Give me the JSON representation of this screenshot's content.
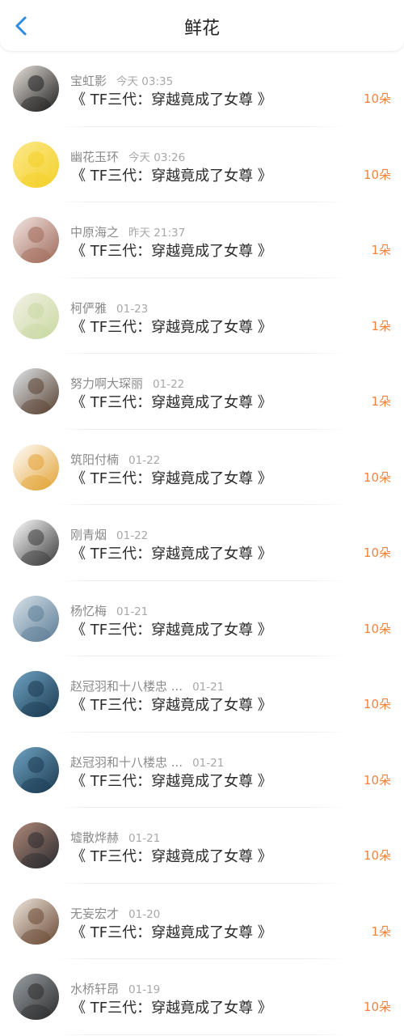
{
  "header": {
    "title": "鲜花",
    "back_icon": "chevron-left-icon",
    "back_color": "#2f8ae0"
  },
  "accent_color": "#f0843e",
  "items": [
    {
      "name": "宝虹影",
      "time": "今天 03:35",
      "book": "《 TF三代：穿越竟成了女尊 》",
      "count": "10朵",
      "avatar": [
        "#1f1f1f",
        "#e8e2dc"
      ]
    },
    {
      "name": "幽花玉环",
      "time": "今天 03:26",
      "book": "《 TF三代：穿越竟成了女尊 》",
      "count": "10朵",
      "avatar": [
        "#f4d02a",
        "#fbe98a"
      ]
    },
    {
      "name": "中原海之",
      "time": "昨天 21:37",
      "book": "《 TF三代：穿越竟成了女尊 》",
      "count": "1朵",
      "avatar": [
        "#a06a5a",
        "#f2e6e2"
      ]
    },
    {
      "name": "柯俨雅",
      "time": "01-23",
      "book": "《 TF三代：穿越竟成了女尊 》",
      "count": "1朵",
      "avatar": [
        "#c9d9a2",
        "#f3f1e6"
      ]
    },
    {
      "name": "努力啊大琛丽",
      "time": "01-22",
      "book": "《 TF三代：穿越竟成了女尊 》",
      "count": "1朵",
      "avatar": [
        "#5a4232",
        "#dfe6ea"
      ]
    },
    {
      "name": "筑阳付楠",
      "time": "01-22",
      "book": "《 TF三代：穿越竟成了女尊 》",
      "count": "10朵",
      "avatar": [
        "#e3a336",
        "#ffffff"
      ]
    },
    {
      "name": "刚青烟",
      "time": "01-22",
      "book": "《 TF三代：穿越竟成了女尊 》",
      "count": "10朵",
      "avatar": [
        "#3a3a3a",
        "#ffffff"
      ]
    },
    {
      "name": "杨忆梅",
      "time": "01-21",
      "book": "《 TF三代：穿越竟成了女尊 》",
      "count": "10朵",
      "avatar": [
        "#5d7d96",
        "#d7e2ea"
      ]
    },
    {
      "name": "赵冠羽和十八楼忠 ...",
      "time": "01-21",
      "book": "《 TF三代：穿越竟成了女尊 》",
      "count": "10朵",
      "avatar": [
        "#1b3a52",
        "#6fa3c2"
      ]
    },
    {
      "name": "赵冠羽和十八楼忠 ...",
      "time": "01-21",
      "book": "《 TF三代：穿越竟成了女尊 》",
      "count": "10朵",
      "avatar": [
        "#1b3a52",
        "#6fa3c2"
      ]
    },
    {
      "name": "墟散烨赫",
      "time": "01-21",
      "book": "《 TF三代：穿越竟成了女尊 》",
      "count": "10朵",
      "avatar": [
        "#2a2a2e",
        "#b08a7a"
      ]
    },
    {
      "name": "无妄宏才",
      "time": "01-20",
      "book": "《 TF三代：穿越竟成了女尊 》",
      "count": "1朵",
      "avatar": [
        "#6b4a36",
        "#efe7dd"
      ]
    },
    {
      "name": "水桥轩昂",
      "time": "01-19",
      "book": "《 TF三代：穿越竟成了女尊 》",
      "count": "10朵",
      "avatar": [
        "#2c2c2c",
        "#9aa0a6"
      ]
    }
  ]
}
